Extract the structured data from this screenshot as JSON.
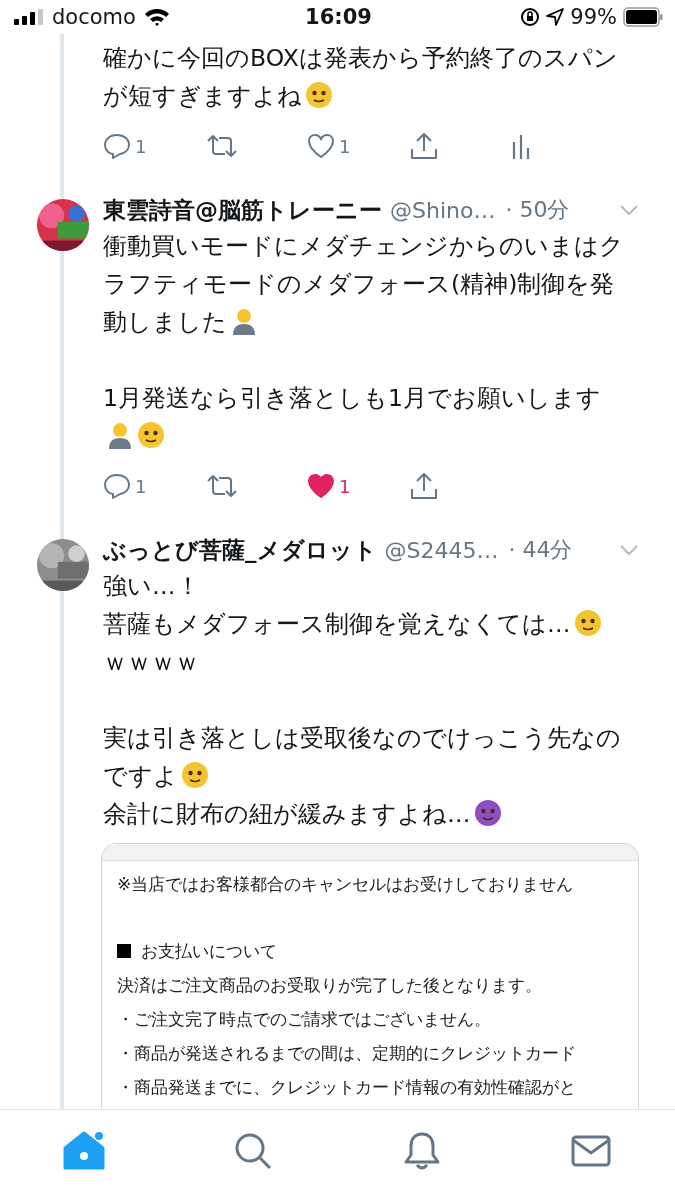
{
  "status_bar": {
    "carrier": "docomo",
    "time": "16:09",
    "battery": "99%"
  },
  "tweets": [
    {
      "paragraphs": [
        {
          "lines": [
            {
              "segments": [
                {
                  "kind": "text",
                  "text": "確かに今回のBOXは発表から予約終了のスパンが短すぎますよね"
                },
                {
                  "kind": "face",
                  "color": "#f5c431"
                }
              ]
            }
          ]
        }
      ],
      "actions": {
        "replies": "1",
        "likes": "1",
        "liked": false,
        "analytics": true
      }
    },
    {
      "avatar": {
        "kind": "picture"
      },
      "name": "東雲詩音@脳筋トレーニー",
      "handle": "@Shino…",
      "time": "· 50分",
      "paragraphs": [
        {
          "lines": [
            {
              "segments": [
                {
                  "kind": "text",
                  "text": "衝動買いモードにメダチェンジからのいまはクラフティモードのメダフォース(精神)制御を発動しました"
                },
                {
                  "kind": "figure",
                  "color": "#f5c431"
                }
              ]
            }
          ]
        },
        {
          "lines": [
            {
              "segments": [
                {
                  "kind": "text",
                  "text": "1月発送なら引き落としも1月でお願いします"
                },
                {
                  "kind": "figure",
                  "color": "#f5c431"
                },
                {
                  "kind": "face",
                  "color": "#f5c431"
                }
              ]
            }
          ]
        }
      ],
      "actions": {
        "replies": "1",
        "likes": "1",
        "liked": true
      }
    },
    {
      "avatar": {
        "kind": "picture"
      },
      "name": "ぶっとび菩薩_メダロット",
      "handle": "@S2445…",
      "time": "· 44分",
      "paragraphs": [
        {
          "lines": [
            {
              "segments": [
                {
                  "kind": "text",
                  "text": "強い…！"
                }
              ]
            },
            {
              "segments": [
                {
                  "kind": "text",
                  "text": "菩薩もメダフォース制御を覚えなくては…"
                },
                {
                  "kind": "face",
                  "color": "#f5c431"
                }
              ]
            },
            {
              "segments": [
                {
                  "kind": "text",
                  "text": "ｗｗｗｗ"
                }
              ]
            }
          ]
        },
        {
          "lines": [
            {
              "segments": [
                {
                  "kind": "text",
                  "text": "実は引き落としは受取後なのでけっこう先なのですよ"
                },
                {
                  "kind": "face",
                  "color": "#f5c431"
                }
              ]
            },
            {
              "segments": [
                {
                  "kind": "text",
                  "text": "余計に財布の紐が緩みますよね…"
                },
                {
                  "kind": "face",
                  "color": "#8e4fc4"
                }
              ]
            }
          ]
        }
      ],
      "card": {
        "lines": [
          {
            "kind": "text",
            "text": "※当店ではお客様都合のキャンセルはお受けしておりません"
          },
          {
            "kind": "blank"
          },
          {
            "kind": "heading",
            "text": "お支払いについて"
          },
          {
            "kind": "text",
            "text": "決済はご注文商品のお受取りが完了した後となります。"
          },
          {
            "kind": "text",
            "text": "・ご注文完了時点でのご請求ではございません。"
          },
          {
            "kind": "text",
            "text": "・商品が発送されるまでの間は、定期的にクレジットカード"
          },
          {
            "kind": "text",
            "text": "・商品発送までに、クレジットカード情報の有効性確認がと"
          }
        ]
      }
    }
  ],
  "tab_bar": [
    {
      "kind": "home",
      "selected": true
    },
    {
      "kind": "search",
      "selected": false
    },
    {
      "kind": "notifications",
      "selected": false
    },
    {
      "kind": "messages",
      "selected": false
    }
  ]
}
